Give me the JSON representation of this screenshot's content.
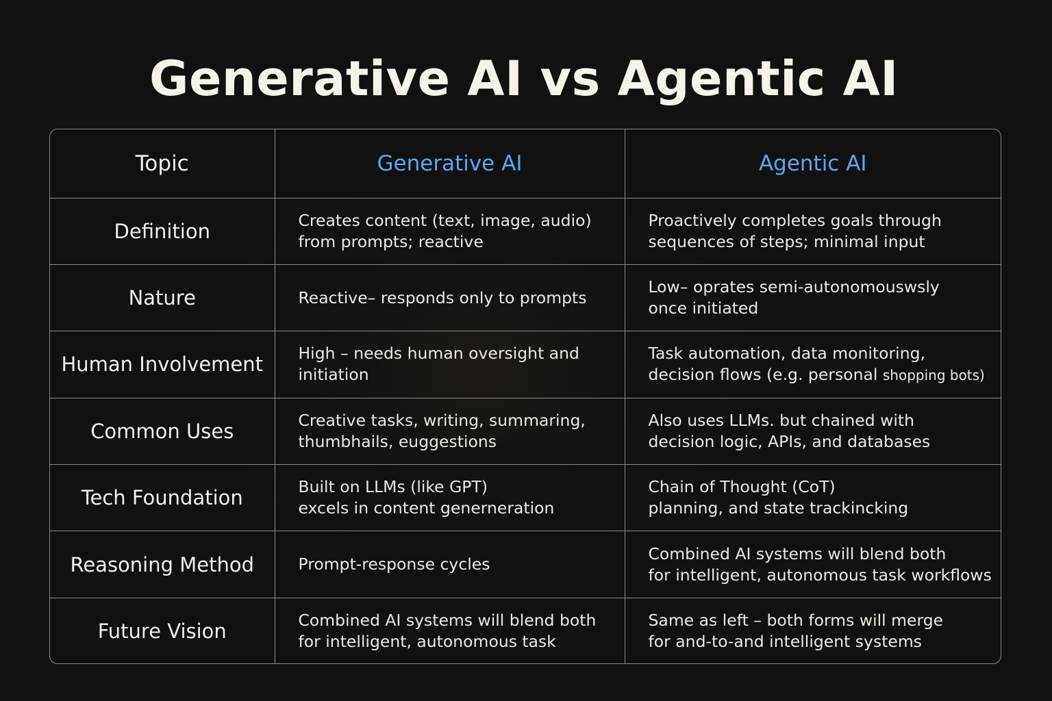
{
  "title": "Generative AI vs Agentic AI",
  "colors": {
    "background": "#111111",
    "text": "#f2f0ea",
    "header_accent": "#5aa8ec",
    "border": "#8a8a8a"
  },
  "table": {
    "headers": {
      "topic": "Topic",
      "generative": "Generative AI",
      "agentic": "Agentic AI"
    },
    "rows": [
      {
        "topic": "Definition",
        "generative": [
          "Creates content (text, image, audio)",
          "from prompts; reactive"
        ],
        "agentic": [
          "Proactively completes goals through",
          "sequences of steps; minimal input"
        ]
      },
      {
        "topic": "Nature",
        "generative": [
          "Reactive– responds only to prompts"
        ],
        "agentic": [
          "Low– oprates semi-autonomouswsly",
          "once initiated"
        ]
      },
      {
        "topic": "Human Involvement",
        "generative": [
          "High – needs human oversight and",
          "initiation"
        ],
        "agentic": [
          "Task automation, data monitoring,",
          "decision flows (e.g. personal ",
          "shopping bots)"
        ]
      },
      {
        "topic": "Common Uses",
        "generative": [
          "Creative tasks, writing, summaring,",
          "thumbhails, euggestions"
        ],
        "agentic": [
          "Also uses LLMs.  but chained with",
          "decision logic, APIs, and databases"
        ]
      },
      {
        "topic": "Tech Foundation",
        "generative": [
          "Built on LLMs (like GPT)",
          "excels in content generneration"
        ],
        "agentic": [
          "Chain of Thought (CoT)",
          "planning, and state trackincking"
        ]
      },
      {
        "topic": "Reasoning Method",
        "generative": [
          "Prompt-response cycles"
        ],
        "agentic": [
          "Combined AI systems will blend both",
          "for intelligent, autonomous task workflows"
        ]
      },
      {
        "topic": "Future Vision",
        "generative": [
          "Combined AI systems will blend both",
          "for intelligent, autonomous task"
        ],
        "agentic": [
          "Same as left – both forms will merge",
          "for and-to-and intelligent systems"
        ]
      }
    ]
  }
}
